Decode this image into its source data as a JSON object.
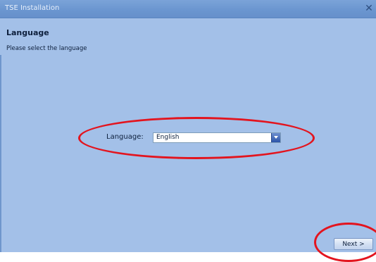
{
  "window": {
    "title": "TSE Installation",
    "close_glyph": "✕"
  },
  "page": {
    "heading": "Language",
    "instruction": "Please select the language"
  },
  "language": {
    "label": "Language:",
    "selected": "English"
  },
  "buttons": {
    "next_label": "Next >"
  },
  "colors": {
    "background": "#a3c0e8",
    "titlebar": "#6b96d0",
    "highlight": "#e3141e"
  }
}
